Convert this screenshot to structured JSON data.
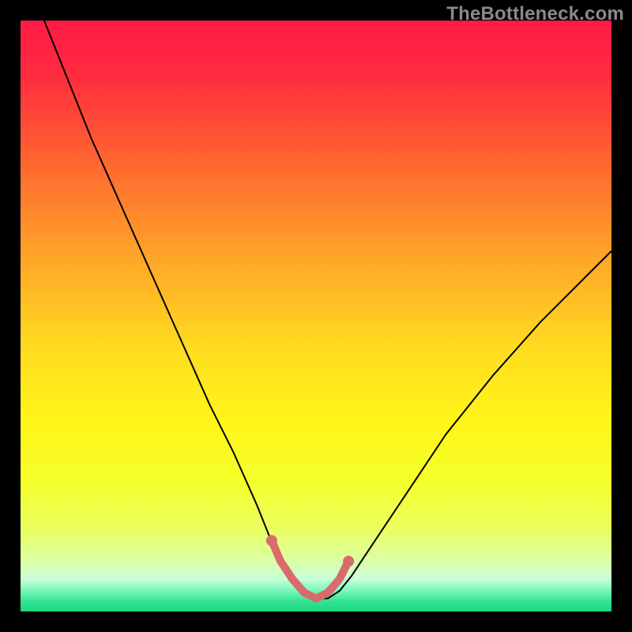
{
  "watermark": "TheBottleneck.com",
  "gradient_stops": [
    {
      "offset": 0.0,
      "color": "#ff1a46"
    },
    {
      "offset": 0.1,
      "color": "#ff2e3e"
    },
    {
      "offset": 0.25,
      "color": "#ff6a2f"
    },
    {
      "offset": 0.4,
      "color": "#ffa528"
    },
    {
      "offset": 0.55,
      "color": "#ffda20"
    },
    {
      "offset": 0.68,
      "color": "#fff61a"
    },
    {
      "offset": 0.78,
      "color": "#f4ff2a"
    },
    {
      "offset": 0.86,
      "color": "#eaff60"
    },
    {
      "offset": 0.91,
      "color": "#ddffa0"
    },
    {
      "offset": 0.945,
      "color": "#c8ffd8"
    },
    {
      "offset": 0.965,
      "color": "#78f7ba"
    },
    {
      "offset": 0.985,
      "color": "#2de28f"
    },
    {
      "offset": 1.0,
      "color": "#1fd97f"
    }
  ],
  "chart_data": {
    "type": "line",
    "title": "",
    "xlabel": "",
    "ylabel": "",
    "xlim": [
      0,
      100
    ],
    "ylim": [
      0,
      100
    ],
    "grid": false,
    "legend": false,
    "series": [
      {
        "name": "bottleneck-curve",
        "color": "#000000",
        "width": 2,
        "x": [
          4,
          8,
          12,
          16,
          20,
          24,
          28,
          32,
          36,
          40,
          42,
          44,
          46,
          48,
          50,
          52,
          54,
          56,
          60,
          66,
          72,
          80,
          88,
          96,
          100
        ],
        "y": [
          100,
          90,
          80,
          71,
          62,
          53,
          44,
          35,
          27,
          18,
          13,
          9,
          6,
          3.5,
          2.2,
          2.2,
          3.5,
          6,
          12,
          21,
          30,
          40,
          49,
          57,
          61
        ]
      },
      {
        "name": "optimal-zone-highlight",
        "color": "#d96b6b",
        "width": 10,
        "x": [
          42.5,
          44,
          46,
          48,
          50,
          52,
          54,
          55.5
        ],
        "y": [
          12,
          8.5,
          5.5,
          3.2,
          2.2,
          3.2,
          5.5,
          8.5
        ]
      },
      {
        "name": "optimal-zone-endpoints",
        "type_hint": "scatter",
        "color": "#d96b6b",
        "radius": 7,
        "x": [
          42.5,
          55.5
        ],
        "y": [
          12,
          8.5
        ]
      }
    ]
  }
}
